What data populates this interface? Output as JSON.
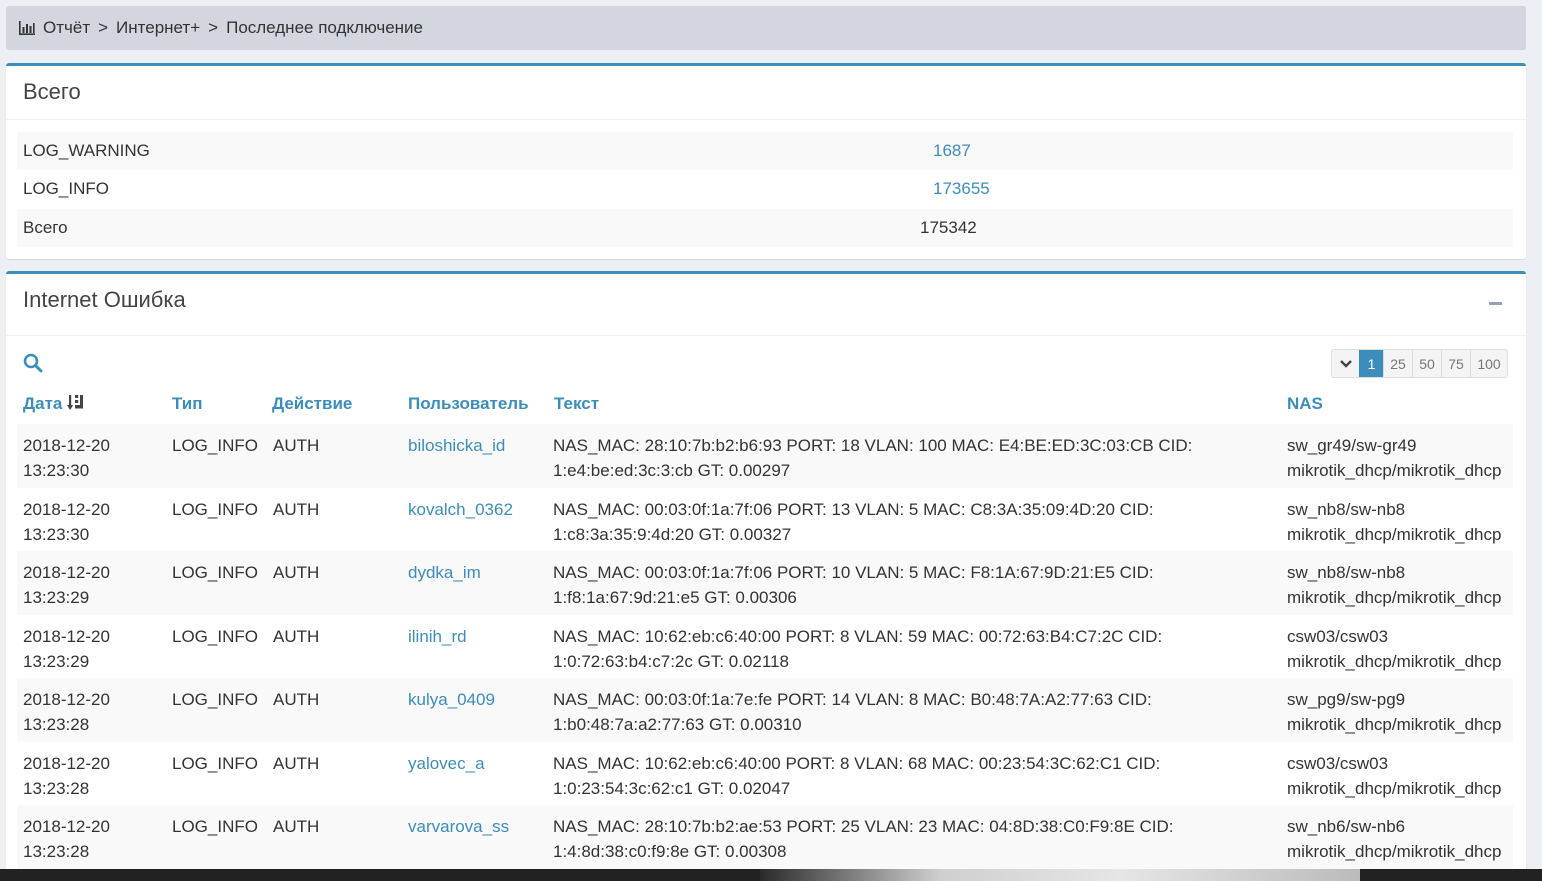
{
  "breadcrumb": {
    "items": [
      "Отчёт",
      "Интернет+",
      "Последнее подключение"
    ],
    "separator": ">"
  },
  "summary": {
    "title": "Всего",
    "rows": [
      {
        "label": "LOG_WARNING",
        "value": "1687",
        "is_link": true
      },
      {
        "label": "LOG_INFO",
        "value": "173655",
        "is_link": true
      },
      {
        "label": "Всего",
        "value": "175342",
        "is_link": false
      }
    ]
  },
  "errors": {
    "title": "Internet Ошибка",
    "pager": {
      "pages": [
        "1",
        "25",
        "50",
        "75",
        "100"
      ],
      "active": "1"
    },
    "columns": {
      "date": "Дата",
      "type": "Тип",
      "action": "Действие",
      "user": "Пользователь",
      "text": "Текст",
      "nas": "NAS"
    },
    "rows": [
      {
        "date": "2018-12-20",
        "time": "13:23:30",
        "type": "LOG_INFO",
        "action": "AUTH",
        "user": "biloshicka_id",
        "text1": "NAS_MAC: 28:10:7b:b2:b6:93 PORT: 18 VLAN: 100 MAC: E4:BE:ED:3C:03:CB CID:",
        "text2": "1:e4:be:ed:3c:3:cb GT: 0.00297",
        "nas1": "sw_gr49/sw-gr49",
        "nas2": "mikrotik_dhcp/mikrotik_dhcp"
      },
      {
        "date": "2018-12-20",
        "time": "13:23:30",
        "type": "LOG_INFO",
        "action": "AUTH",
        "user": "kovalch_0362",
        "text1": "NAS_MAC: 00:03:0f:1a:7f:06 PORT: 13 VLAN: 5 MAC: C8:3A:35:09:4D:20 CID:",
        "text2": "1:c8:3a:35:9:4d:20 GT: 0.00327",
        "nas1": "sw_nb8/sw-nb8",
        "nas2": "mikrotik_dhcp/mikrotik_dhcp"
      },
      {
        "date": "2018-12-20",
        "time": "13:23:29",
        "type": "LOG_INFO",
        "action": "AUTH",
        "user": "dydka_im",
        "text1": "NAS_MAC: 00:03:0f:1a:7f:06 PORT: 10 VLAN: 5 MAC: F8:1A:67:9D:21:E5 CID:",
        "text2": "1:f8:1a:67:9d:21:e5 GT: 0.00306",
        "nas1": "sw_nb8/sw-nb8",
        "nas2": "mikrotik_dhcp/mikrotik_dhcp"
      },
      {
        "date": "2018-12-20",
        "time": "13:23:29",
        "type": "LOG_INFO",
        "action": "AUTH",
        "user": "ilinih_rd",
        "text1": "NAS_MAC: 10:62:eb:c6:40:00 PORT: 8 VLAN: 59 MAC: 00:72:63:B4:C7:2C CID:",
        "text2": "1:0:72:63:b4:c7:2c GT: 0.02118",
        "nas1": "csw03/csw03",
        "nas2": "mikrotik_dhcp/mikrotik_dhcp"
      },
      {
        "date": "2018-12-20",
        "time": "13:23:28",
        "type": "LOG_INFO",
        "action": "AUTH",
        "user": "kulya_0409",
        "text1": "NAS_MAC: 00:03:0f:1a:7e:fe PORT: 14 VLAN: 8 MAC: B0:48:7A:A2:77:63 CID:",
        "text2": "1:b0:48:7a:a2:77:63 GT: 0.00310",
        "nas1": "sw_pg9/sw-pg9",
        "nas2": "mikrotik_dhcp/mikrotik_dhcp"
      },
      {
        "date": "2018-12-20",
        "time": "13:23:28",
        "type": "LOG_INFO",
        "action": "AUTH",
        "user": "yalovec_a",
        "text1": "NAS_MAC: 10:62:eb:c6:40:00 PORT: 8 VLAN: 68 MAC: 00:23:54:3C:62:C1 CID:",
        "text2": "1:0:23:54:3c:62:c1 GT: 0.02047",
        "nas1": "csw03/csw03",
        "nas2": "mikrotik_dhcp/mikrotik_dhcp"
      },
      {
        "date": "2018-12-20",
        "time": "13:23:28",
        "type": "LOG_INFO",
        "action": "AUTH",
        "user": "varvarova_ss",
        "text1": "NAS_MAC: 28:10:7b:b2:ae:53 PORT: 25 VLAN: 23 MAC: 04:8D:38:C0:F9:8E CID:",
        "text2": "1:4:8d:38:c0:f9:8e GT: 0.00308",
        "nas1": "sw_nb6/sw-nb6",
        "nas2": "mikrotik_dhcp/mikrotik_dhcp"
      }
    ]
  },
  "colors": {
    "accent": "#3c8dbc",
    "breadcrumb_bg": "#d2d6de",
    "page_bg": "#ecf0f5"
  },
  "icons": {
    "breadcrumb": "bar-chart-icon",
    "search": "search-icon",
    "sort": "sort-desc-icon",
    "collapse": "minus-icon",
    "dropdown": "chevron-down-icon"
  }
}
